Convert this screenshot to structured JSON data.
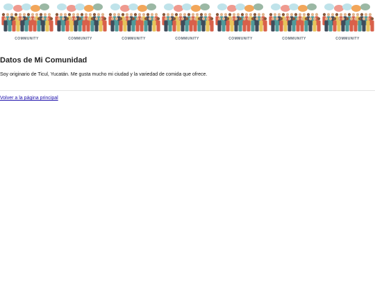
{
  "banner": {
    "tile_count": 7,
    "caption": "COMMUNITY",
    "colors": {
      "bubble_blue": "#bfe3ea",
      "bubble_orange": "#f2a65a",
      "bubble_pink": "#ef9a8f",
      "bubble_green": "#9bb8a4",
      "people_dark": "#3f4c5c",
      "people_red": "#d9604a",
      "people_teal": "#4f9a9a",
      "people_yellow": "#e8c45a"
    }
  },
  "page": {
    "title": "Datos de Mi Comunidad",
    "description": "Soy originario de Ticul, Yucatán. Me gusta mucho mi ciudad y la variedad de comida que ofrece.",
    "back_link": "Volver a la página principal"
  }
}
